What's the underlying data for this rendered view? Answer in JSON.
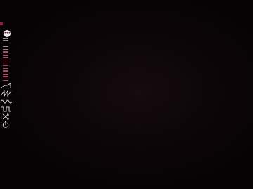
{
  "app": {
    "background": "#070304",
    "accent": "#b0446a",
    "indicator_color": "#8a1a30"
  },
  "sidebar": {
    "add_button": {
      "icon": "more-dots-icon",
      "glyph": "•••"
    },
    "layers": [
      {
        "name": "layer-1",
        "color": "grey"
      },
      {
        "name": "layer-2",
        "color": "grey"
      },
      {
        "name": "layer-3",
        "color": "pink"
      },
      {
        "name": "layer-4",
        "color": "pink"
      },
      {
        "name": "layer-5",
        "color": "pink"
      },
      {
        "name": "layer-6",
        "color": "pink"
      },
      {
        "name": "layer-7",
        "color": "pink"
      }
    ],
    "wave_tools": [
      {
        "name": "ramp-wave-icon"
      },
      {
        "name": "sawtooth-wave-icon"
      },
      {
        "name": "sine-wave-icon"
      },
      {
        "name": "square-wave-icon"
      },
      {
        "name": "shuffle-icon"
      },
      {
        "name": "timer-icon"
      }
    ]
  }
}
